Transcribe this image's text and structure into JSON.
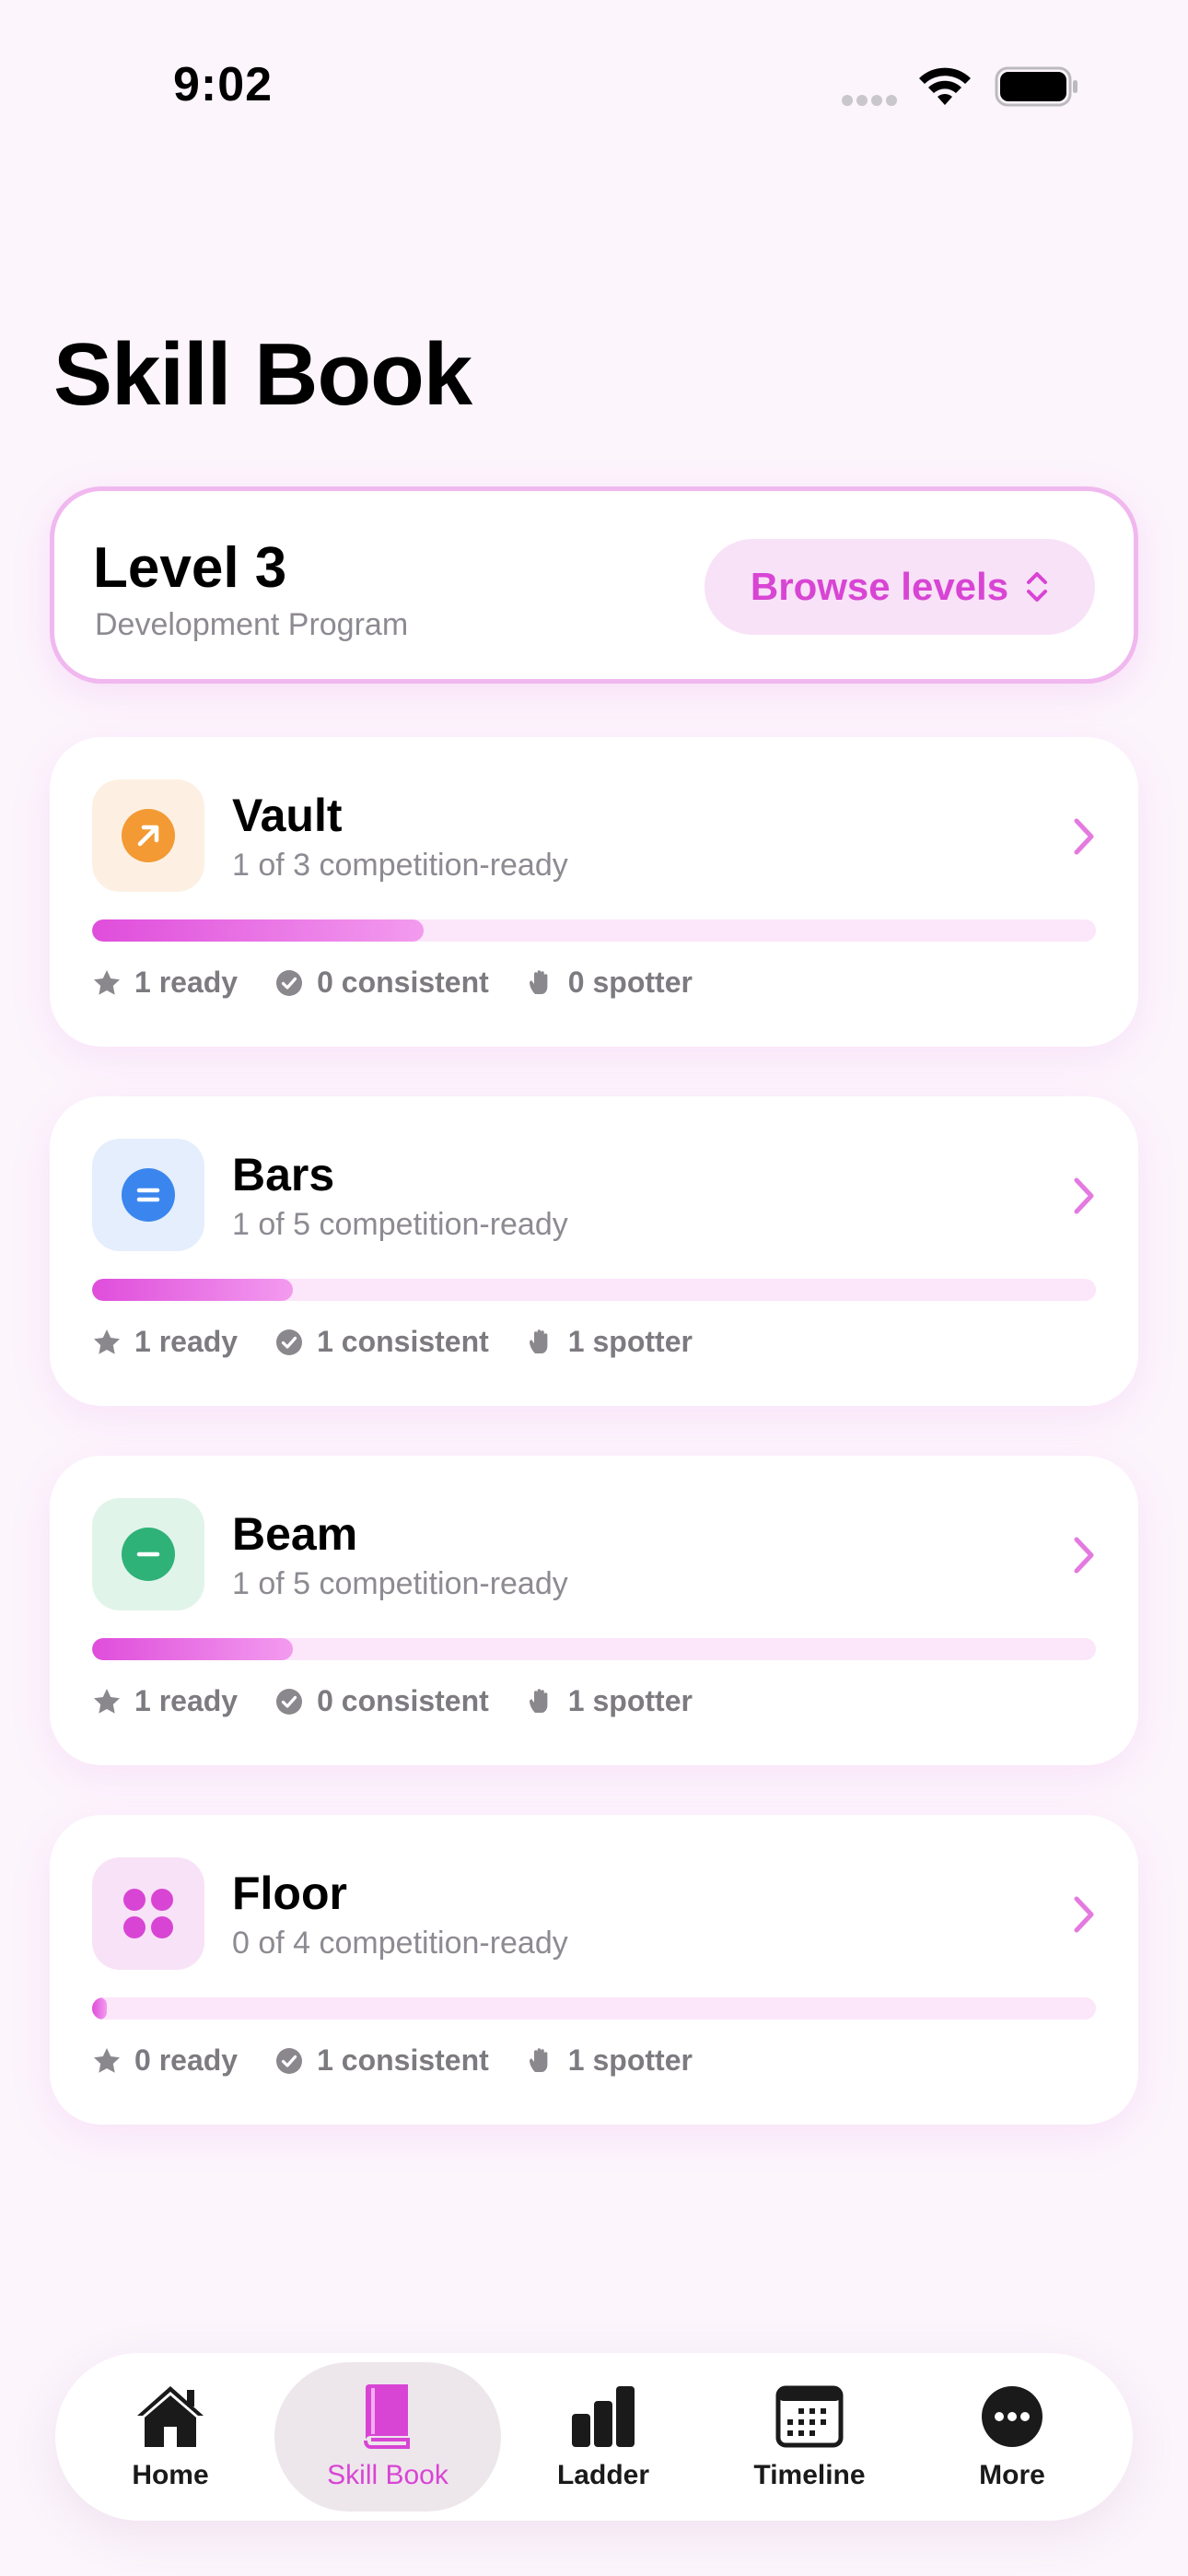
{
  "status_bar": {
    "time": "9:02"
  },
  "page": {
    "title": "Skill Book"
  },
  "level_card": {
    "title": "Level 3",
    "subtitle": "Development Program",
    "browse_label": "Browse levels"
  },
  "apparatus": [
    {
      "name": "Vault",
      "subtitle": "1 of 3 competition-ready",
      "progress": 0.33,
      "icon": "arrow-up-right-icon",
      "accent": "#f39a34",
      "tile": "#fdf0e3",
      "ready": "1 ready",
      "consistent": "0 consistent",
      "spotter": "0 spotter"
    },
    {
      "name": "Bars",
      "subtitle": "1 of 5 competition-ready",
      "progress": 0.2,
      "icon": "equals-icon",
      "accent": "#3b86ee",
      "tile": "#e5eefc",
      "ready": "1 ready",
      "consistent": "1 consistent",
      "spotter": "1 spotter"
    },
    {
      "name": "Beam",
      "subtitle": "1 of 5 competition-ready",
      "progress": 0.2,
      "icon": "minus-icon",
      "accent": "#2fb277",
      "tile": "#e1f4ea",
      "ready": "1 ready",
      "consistent": "0 consistent",
      "spotter": "1 spotter"
    },
    {
      "name": "Floor",
      "subtitle": "0 of 4 competition-ready",
      "progress": 0.0,
      "icon": "four-dots-icon",
      "accent": "#d845d4",
      "tile": "#f8e2f7",
      "ready": "0 ready",
      "consistent": "1 consistent",
      "spotter": "1 spotter"
    }
  ],
  "tab_bar": {
    "tabs": [
      {
        "label": "Home",
        "icon": "house-icon"
      },
      {
        "label": "Skill Book",
        "icon": "book-icon",
        "active": true
      },
      {
        "label": "Ladder",
        "icon": "bars-icon"
      },
      {
        "label": "Timeline",
        "icon": "calendar-icon"
      },
      {
        "label": "More",
        "icon": "more-icon"
      }
    ]
  },
  "colors": {
    "accent": "#d845d4",
    "progress_track": "#fbe6fa",
    "background": "#fcf5fc"
  }
}
